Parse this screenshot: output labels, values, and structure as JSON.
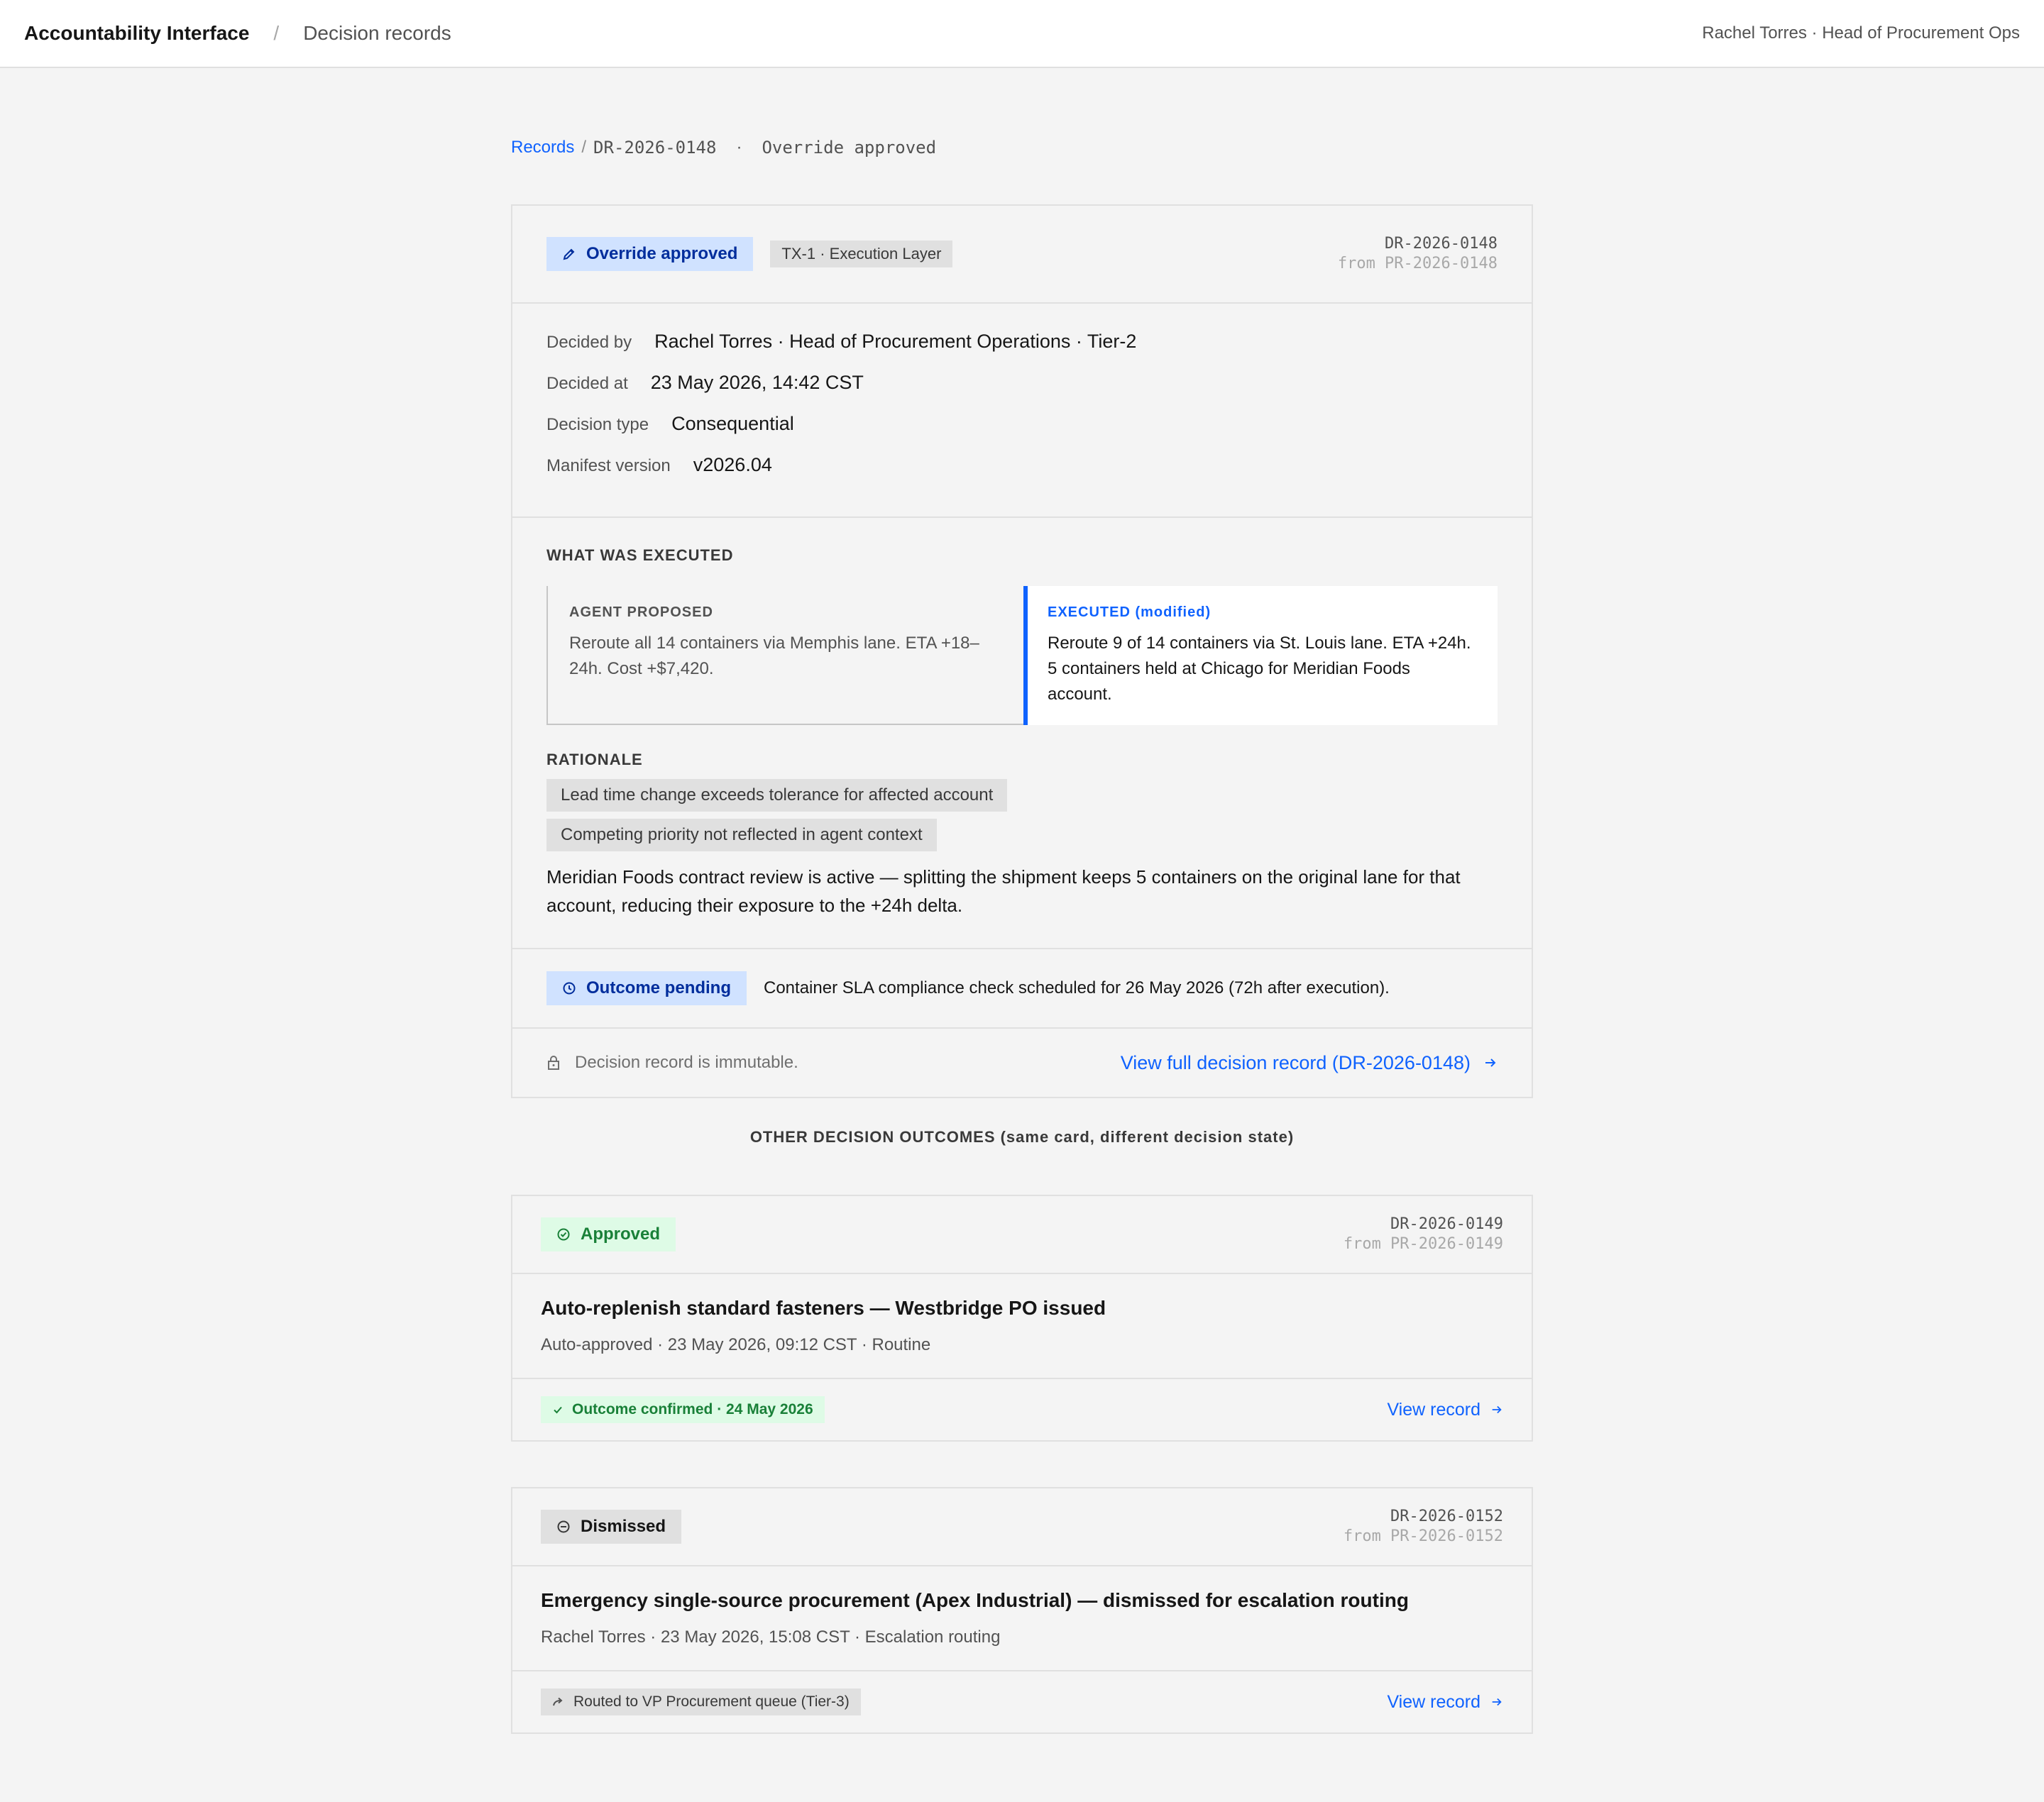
{
  "header": {
    "app_title": "Accountability Interface",
    "separator": "/",
    "section": "Decision records",
    "user": "Rachel Torres · Head of Procurement Ops"
  },
  "breadcrumb": {
    "root": "Records",
    "slash": "/",
    "record_id": "DR-2026-0148",
    "dot": "·",
    "state": "Override approved"
  },
  "main_card": {
    "status_tag": "Override approved",
    "layer_tag": "TX-1 · Execution Layer",
    "record_id": "DR-2026-0148",
    "source_id": "from PR-2026-0148",
    "meta": [
      {
        "key": "Decided by",
        "value": "Rachel Torres · Head of Procurement Operations · Tier-2"
      },
      {
        "key": "Decided at",
        "value": "23 May 2026, 14:42 CST"
      },
      {
        "key": "Decision type",
        "value": "Consequential"
      },
      {
        "key": "Manifest version",
        "value": "v2026.04"
      }
    ],
    "executed_title": "WHAT WAS EXECUTED",
    "agent_label": "AGENT PROPOSED",
    "agent_text": "Reroute all 14 containers via Memphis lane. ETA +18–24h. Cost +$7,420.",
    "executed_label": "EXECUTED (modified)",
    "executed_text": "Reroute 9 of 14 containers via St. Louis lane. ETA +24h. 5 containers held at Chicago for Meridian Foods account.",
    "rationale_title": "RATIONALE",
    "rationale_chips": [
      "Lead time change exceeds tolerance for affected account",
      "Competing priority not reflected in agent context"
    ],
    "rationale_text": "Meridian Foods contract review is active — splitting the shipment keeps 5 containers on the original lane for that account, reducing their exposure to the +24h delta.",
    "outcome_tag": "Outcome pending",
    "outcome_text": "Container SLA compliance check scheduled for 26 May 2026 (72h after execution).",
    "immutable_text": "Decision record is immutable.",
    "view_link": "View full decision record (DR-2026-0148)"
  },
  "other_title": "OTHER DECISION OUTCOMES (same card, different decision state)",
  "other_cards": [
    {
      "status_tag": "Approved",
      "record_id": "DR-2026-0149",
      "source_id": "from PR-2026-0149",
      "title": "Auto-replenish standard fasteners — Westbridge PO issued",
      "subtitle": "Auto-approved · 23 May 2026, 09:12 CST · Routine",
      "foot_tag": "Outcome confirmed · 24 May 2026",
      "view_link": "View record"
    },
    {
      "status_tag": "Dismissed",
      "record_id": "DR-2026-0152",
      "source_id": "from PR-2026-0152",
      "title": "Emergency single-source procurement (Apex Industrial) — dismissed for escalation routing",
      "subtitle": "Rachel Torres · 23 May 2026, 15:08 CST · Escalation routing",
      "foot_tag": "Routed to VP Procurement queue (Tier-3)",
      "view_link": "View record"
    }
  ],
  "colors": {
    "accent": "#0f62fe",
    "success": "#198038",
    "success_bg": "#defbe6",
    "info_bg": "#d0e2ff"
  }
}
